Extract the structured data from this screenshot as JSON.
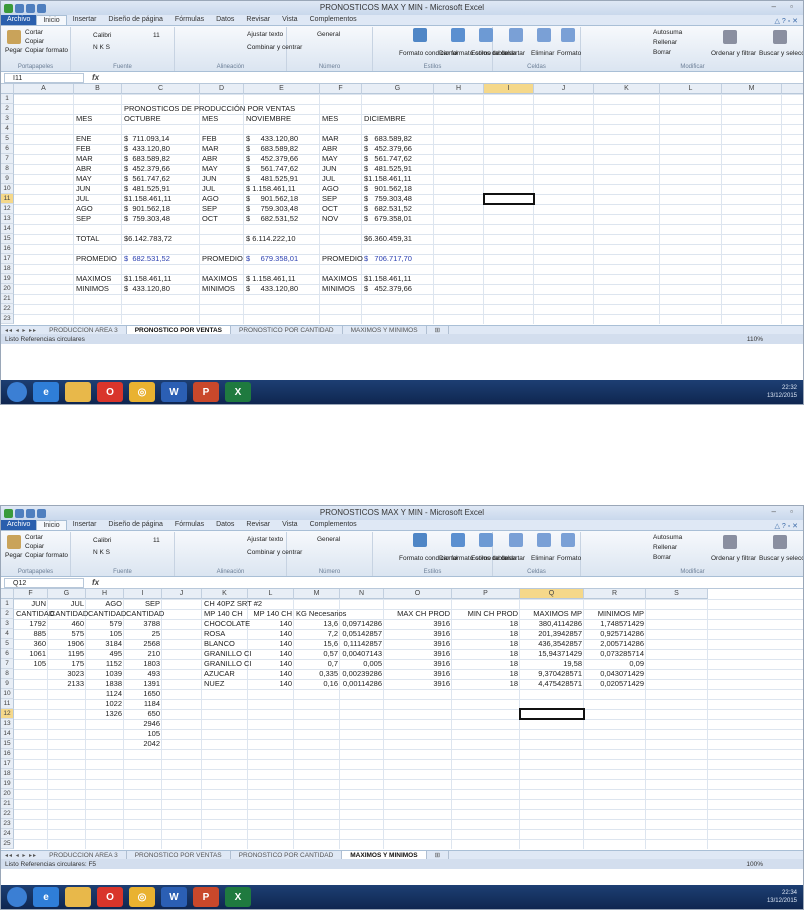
{
  "window1": {
    "title": "PRONOSTICOS MAX Y MIN - Microsoft Excel",
    "tabs": [
      "Archivo",
      "Inicio",
      "Insertar",
      "Diseño de página",
      "Fórmulas",
      "Datos",
      "Revisar",
      "Vista",
      "Complementos"
    ],
    "ribbon": {
      "clipboard": {
        "paste": "Pegar",
        "cut": "Cortar",
        "copy": "Copiar",
        "format": "Copiar formato",
        "label": "Portapapeles"
      },
      "font": {
        "name": "Calibri",
        "size": "11",
        "label": "Fuente"
      },
      "align": {
        "wrap": "Ajustar texto",
        "merge": "Combinar y centrar",
        "label": "Alineación"
      },
      "number": {
        "format": "General",
        "label": "Número"
      },
      "styles": {
        "cond": "Formato condicional",
        "table": "Dar formato como tabla",
        "cell": "Estilos de celda",
        "label": "Estilos"
      },
      "cells": {
        "insert": "Insertar",
        "delete": "Eliminar",
        "format": "Formato",
        "label": "Celdas"
      },
      "edit": {
        "autosum": "Autosuma",
        "fill": "Rellenar",
        "clear": "Borrar",
        "sort": "Ordenar y filtrar",
        "find": "Buscar y seleccionar",
        "label": "Modificar"
      }
    },
    "namebox": "I11",
    "columns": [
      "A",
      "B",
      "C",
      "D",
      "E",
      "F",
      "G",
      "H",
      "I",
      "J",
      "K",
      "L",
      "M",
      "N"
    ],
    "rows": [
      [
        "",
        "",
        "",
        "",
        "",
        "",
        ""
      ],
      [
        "",
        "",
        "PRONOSTICOS DE PRODUCCIÓN POR VENTAS",
        "",
        "",
        "",
        ""
      ],
      [
        "",
        "MES",
        "OCTUBRE",
        "MES",
        "NOVIEMBRE",
        "MES",
        "DICIEMBRE"
      ],
      [
        "",
        "",
        "",
        "",
        "",
        "",
        ""
      ],
      [
        "",
        "ENE",
        "$  711.093,14",
        "FEB",
        "$     433.120,80",
        "MAR",
        "$   683.589,82"
      ],
      [
        "",
        "FEB",
        "$  433.120,80",
        "MAR",
        "$     683.589,82",
        "ABR",
        "$   452.379,66"
      ],
      [
        "",
        "MAR",
        "$  683.589,82",
        "ABR",
        "$     452.379,66",
        "MAY",
        "$   561.747,62"
      ],
      [
        "",
        "ABR",
        "$  452.379,66",
        "MAY",
        "$     561.747,62",
        "JUN",
        "$   481.525,91"
      ],
      [
        "",
        "MAY",
        "$  561.747,62",
        "JUN",
        "$     481.525,91",
        "JUL",
        "$1.158.461,11"
      ],
      [
        "",
        "JUN",
        "$  481.525,91",
        "JUL",
        "$ 1.158.461,11",
        "AGO",
        "$   901.562,18"
      ],
      [
        "",
        "JUL",
        "$1.158.461,11",
        "AGO",
        "$     901.562,18",
        "SEP",
        "$   759.303,48"
      ],
      [
        "",
        "AGO",
        "$  901.562,18",
        "SEP",
        "$     759.303,48",
        "OCT",
        "$   682.531,52"
      ],
      [
        "",
        "SEP",
        "$  759.303,48",
        "OCT",
        "$     682.531,52",
        "NOV",
        "$   679.358,01"
      ],
      [
        "",
        "",
        "",
        "",
        "",
        "",
        ""
      ],
      [
        "",
        "TOTAL",
        "$6.142.783,72",
        "",
        "$ 6.114.222,10",
        "",
        "$6.360.459,31"
      ],
      [
        "",
        "",
        "",
        "",
        "",
        "",
        ""
      ],
      [
        "",
        "PROMEDIO",
        "$  682.531,52",
        "PROMEDIO",
        "$     679.358,01",
        "PROMEDIO",
        "$   706.717,70"
      ],
      [
        "",
        "",
        "",
        "",
        "",
        "",
        ""
      ],
      [
        "",
        "MAXIMOS",
        "$1.158.461,11",
        "MAXIMOS",
        "$ 1.158.461,11",
        "MAXIMOS",
        "$1.158.461,11"
      ],
      [
        "",
        "MINIMOS",
        "$  433.120,80",
        "MINIMOS",
        "$     433.120,80",
        "MINIMOS",
        "$   452.379,66"
      ]
    ],
    "row_count": 23,
    "sheets": [
      "PRODUCCION AREA 3",
      "PRONOSTICO POR VENTAS",
      "PRONOSTICO POR CANTIDAD",
      "MAXIMOS Y MINIMOS"
    ],
    "active_sheet": "PRONOSTICO POR VENTAS",
    "status": "Listo   Referencias circulares",
    "zoom": "110%",
    "clock": "22:32",
    "date": "13/12/2015"
  },
  "window2": {
    "title": "PRONOSTICOS MAX Y MIN - Microsoft Excel",
    "namebox": "Q12",
    "columns": [
      "F",
      "G",
      "H",
      "I",
      "J",
      "K",
      "L",
      "M",
      "N",
      "O",
      "P",
      "Q",
      "R",
      "S"
    ],
    "rows": [
      [
        "JUN",
        "JUL",
        "AGO",
        "SEP",
        "",
        "CH 40PZ SRT #2",
        "",
        "",
        "",
        "",
        "",
        "",
        ""
      ],
      [
        "CANTIDAD",
        "CANTIDAD",
        "CANTIDAD",
        "CANTIDAD",
        "",
        "MP 140 CH",
        "MP 140 CH",
        "KG Necesarios",
        "",
        "MAX CH PROD",
        "MIN CH PROD",
        "MAXIMOS MP",
        "MINIMOS MP"
      ],
      [
        "1792",
        "460",
        "579",
        "3788",
        "",
        "CHOCOLATE",
        "140",
        "13,6",
        "0,09714286",
        "3916",
        "18",
        "380,4114286",
        "1,748571429"
      ],
      [
        "885",
        "575",
        "105",
        "25",
        "",
        "ROSA",
        "140",
        "7,2",
        "0,05142857",
        "3916",
        "18",
        "201,3942857",
        "0,925714286"
      ],
      [
        "360",
        "1906",
        "3184",
        "2568",
        "",
        "BLANCO",
        "140",
        "15,6",
        "0,11142857",
        "3916",
        "18",
        "436,3542857",
        "2,005714286"
      ],
      [
        "1061",
        "1195",
        "495",
        "210",
        "",
        "GRANILLO CI",
        "140",
        "0,57",
        "0,00407143",
        "3916",
        "18",
        "15,94371429",
        "0,073285714"
      ],
      [
        "105",
        "175",
        "1152",
        "1803",
        "",
        "GRANILLO CI",
        "140",
        "0,7",
        "0,005",
        "3916",
        "18",
        "19,58",
        "0,09"
      ],
      [
        "",
        "3023",
        "1039",
        "493",
        "",
        "AZUCAR",
        "140",
        "0,335",
        "0,00239286",
        "3916",
        "18",
        "9,370428571",
        "0,043071429"
      ],
      [
        "",
        "2133",
        "1838",
        "1391",
        "",
        "NUEZ",
        "140",
        "0,16",
        "0,00114286",
        "3916",
        "18",
        "4,475428571",
        "0,020571429"
      ],
      [
        "",
        "",
        "1124",
        "1650",
        "",
        "",
        "",
        "",
        "",
        "",
        "",
        "",
        ""
      ],
      [
        "",
        "",
        "1022",
        "1184",
        "",
        "",
        "",
        "",
        "",
        "",
        "",
        "",
        ""
      ],
      [
        "",
        "",
        "1326",
        "650",
        "",
        "",
        "",
        "",
        "",
        "",
        "",
        "",
        ""
      ],
      [
        "",
        "",
        "",
        "2946",
        "",
        "",
        "",
        "",
        "",
        "",
        "",
        "",
        ""
      ],
      [
        "",
        "",
        "",
        "105",
        "",
        "",
        "",
        "",
        "",
        "",
        "",
        "",
        ""
      ],
      [
        "",
        "",
        "",
        "2042",
        "",
        "",
        "",
        "",
        "",
        "",
        "",
        "",
        ""
      ]
    ],
    "row_count": 25,
    "sheets": [
      "PRODUCCION AREA 3",
      "PRONOSTICO POR VENTAS",
      "PRONOSTICO POR CANTIDAD",
      "MAXIMOS Y MINIMOS"
    ],
    "active_sheet": "MAXIMOS Y MINIMOS",
    "status": "Listo   Referencias circulares: F5",
    "zoom": "100%",
    "clock": "22:34",
    "date": "13/12/2015"
  },
  "taskbar_icons": [
    "start-orb",
    "internet-explorer",
    "file-explorer",
    "opera",
    "chrome",
    "word",
    "powerpoint",
    "excel"
  ],
  "colors": {
    "accent": "#2a5fad",
    "ribbon": "#dbe5f1",
    "header_highlight": "#f5d88a",
    "blue_text": "#2a3fb0"
  }
}
